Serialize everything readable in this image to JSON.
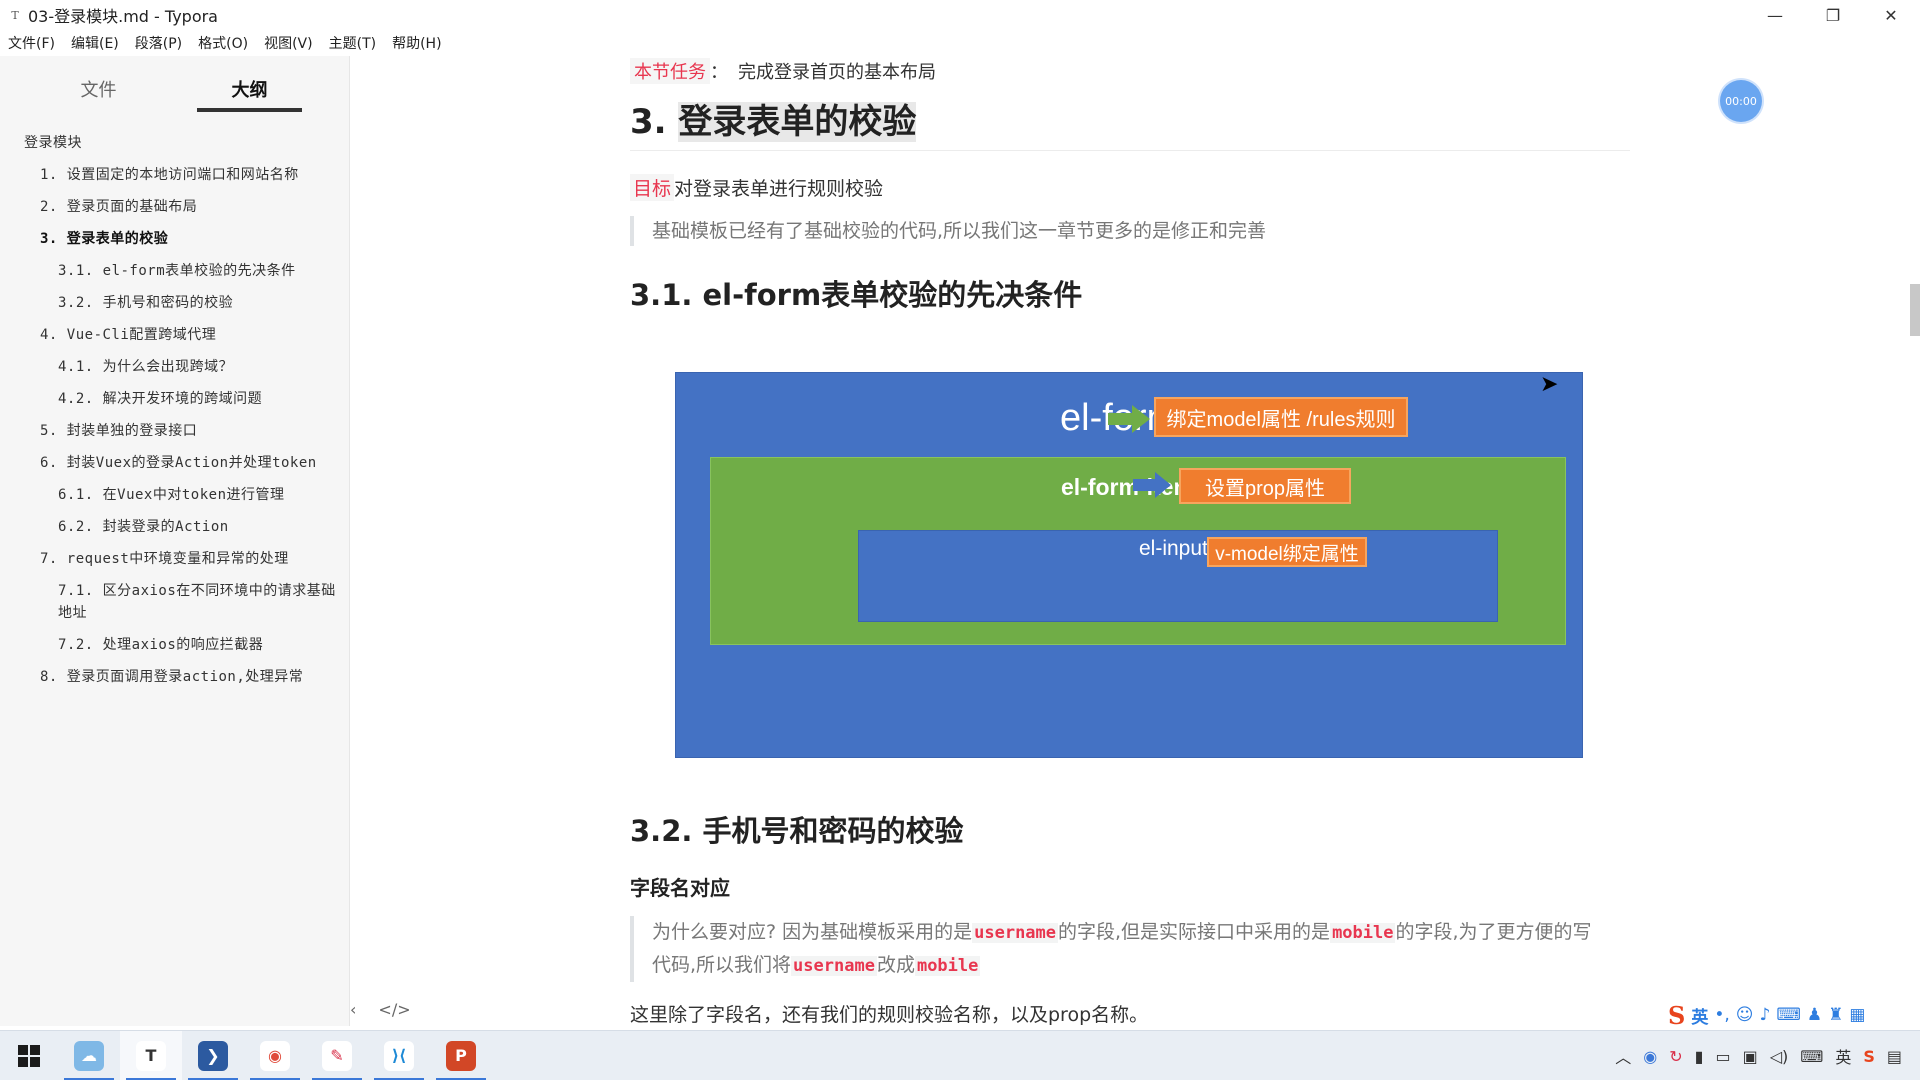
{
  "window": {
    "app_icon": "T",
    "title": "03-登录模块.md - Typora",
    "controls": [
      "—",
      "❐",
      "✕"
    ]
  },
  "menu": [
    "文件(F)",
    "编辑(E)",
    "段落(P)",
    "格式(O)",
    "视图(V)",
    "主题(T)",
    "帮助(H)"
  ],
  "sidebar": {
    "tabs": [
      {
        "label": "文件",
        "active": false
      },
      {
        "label": "大纲",
        "active": true
      }
    ],
    "outline": [
      {
        "text": "登录模块",
        "level": 0,
        "bold": false
      },
      {
        "text": "1. 设置固定的本地访问端口和网站名称",
        "level": 1,
        "bold": false
      },
      {
        "text": "2. 登录页面的基础布局",
        "level": 1,
        "bold": false
      },
      {
        "text": "3. 登录表单的校验",
        "level": 1,
        "bold": true
      },
      {
        "text": "3.1. el-form表单校验的先决条件",
        "level": 2,
        "bold": false
      },
      {
        "text": "3.2. 手机号和密码的校验",
        "level": 2,
        "bold": false
      },
      {
        "text": "4. Vue-Cli配置跨域代理",
        "level": 1,
        "bold": false
      },
      {
        "text": "4.1. 为什么会出现跨域？",
        "level": 2,
        "bold": false
      },
      {
        "text": "4.2. 解决开发环境的跨域问题",
        "level": 2,
        "bold": false
      },
      {
        "text": "5. 封装单独的登录接口",
        "level": 1,
        "bold": false
      },
      {
        "text": "6. 封装Vuex的登录Action并处理token",
        "level": 1,
        "bold": false
      },
      {
        "text": "6.1. 在Vuex中对token进行管理",
        "level": 2,
        "bold": false
      },
      {
        "text": "6.2. 封装登录的Action",
        "level": 2,
        "bold": false
      },
      {
        "text": "7. request中环境变量和异常的处理",
        "level": 1,
        "bold": false
      },
      {
        "text": "7.1. 区分axios在不同环境中的请求基础地址",
        "level": 2,
        "bold": false
      },
      {
        "text": "7.2. 处理axios的响应拦截器",
        "level": 2,
        "bold": false
      },
      {
        "text": "8. 登录页面调用登录action,处理异常",
        "level": 1,
        "bold": false
      }
    ],
    "footer": {
      "back": "‹",
      "source": "</>"
    }
  },
  "content": {
    "task_label": "本节任务",
    "task_colon": "：",
    "task_text": "完成登录首页的基本布局",
    "h3_number": "3. ",
    "h3_title": "登录表单的校验",
    "goal_tag": "目标",
    "goal_text": "对登录表单进行规则校验",
    "quote1": "基础模板已经有了基础校验的代码,所以我们这一章节更多的是修正和完善",
    "h31": "3.1. el-form表单校验的先决条件",
    "diagram": {
      "form_label": "el-form",
      "form_box": "绑定model属性 /rules规则",
      "item_label": "el-form-item",
      "item_box": "设置prop属性",
      "input_label": "el-input",
      "input_box": "v-model绑定属性",
      "colors": {
        "blue": "#4472c4",
        "green": "#70ad47",
        "orange": "#f07d2e"
      }
    },
    "h32": "3.2. 手机号和密码的校验",
    "field_heading": "字段名对应",
    "quote2": {
      "part1": "为什么要对应? 因为基础模板采用的是",
      "code1": "username",
      "part2": "的字段,但是实际接口中采用的是",
      "code2": "mobile",
      "part3": "的字段,为了更方便的写代码,所以我们将",
      "code3": "username",
      "part4": "改成",
      "code4": "mobile"
    },
    "bottom_para": "这里除了字段名，还有我们的规则校验名称，以及prop名称。"
  },
  "timer": "00:00",
  "ime": {
    "lang": "英",
    "icons": [
      "punctuation-icon",
      "emoji-icon",
      "mic-icon",
      "keyboard-icon",
      "user-icon",
      "skin-icon",
      "grid-icon"
    ]
  },
  "taskbar": {
    "apps": [
      {
        "name": "cloud-drive",
        "glyph": "☁",
        "bg": "#7fb8e6",
        "fg": "#ffffff",
        "running": true,
        "active": false
      },
      {
        "name": "typora",
        "glyph": "T",
        "bg": "#ffffff",
        "fg": "#333333",
        "running": true,
        "active": true
      },
      {
        "name": "powershell",
        "glyph": "❯",
        "bg": "#2c5aa0",
        "fg": "#ffffff",
        "running": true,
        "active": false
      },
      {
        "name": "chrome",
        "glyph": "◉",
        "bg": "#ffffff",
        "fg": "#e04a3a",
        "running": true,
        "active": false
      },
      {
        "name": "snipaste",
        "glyph": "✎",
        "bg": "#ffffff",
        "fg": "#d9304a",
        "running": true,
        "active": false
      },
      {
        "name": "vscode",
        "glyph": "⟩⟨",
        "bg": "#ffffff",
        "fg": "#1e8ad6",
        "running": true,
        "active": false
      },
      {
        "name": "powerpoint",
        "glyph": "P",
        "bg": "#d24726",
        "fg": "#ffffff",
        "running": true,
        "active": false
      }
    ]
  }
}
